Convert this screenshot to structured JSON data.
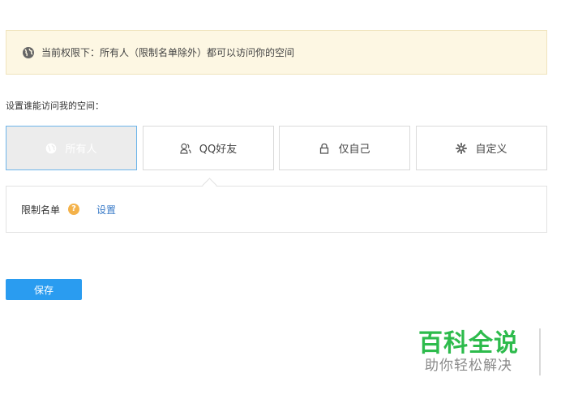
{
  "notice": {
    "icon": "globe-icon",
    "text": "当前权限下：所有人（限制名单除外）都可以访问你的空间"
  },
  "section_label": "设置谁能访问我的空间：",
  "options": [
    {
      "label": "所有人",
      "icon": "globe-icon",
      "selected": true
    },
    {
      "label": "QQ好友",
      "icon": "friends-icon",
      "selected": false
    },
    {
      "label": "仅自己",
      "icon": "lock-icon",
      "selected": false
    },
    {
      "label": "自定义",
      "icon": "gear-icon",
      "selected": false
    }
  ],
  "restriction": {
    "label": "限制名单",
    "help_glyph": "?",
    "link": "设置"
  },
  "save_label": "保存",
  "watermark": {
    "title": "百科全说",
    "subtitle": "助你轻松解决"
  },
  "colors": {
    "accent": "#2a9cf0",
    "notice_bg": "#fdf7e3",
    "watermark_green": "#2dbb4c"
  }
}
